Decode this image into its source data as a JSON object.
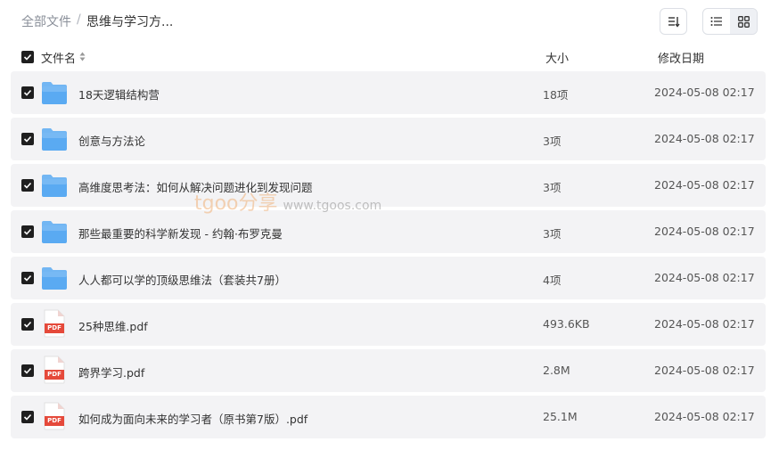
{
  "breadcrumb": {
    "root": "全部文件",
    "separator": "/",
    "current": "思维与学习方..."
  },
  "toolbar": {
    "sort_icon": "sort-icon",
    "list_view_icon": "list-view-icon",
    "grid_view_icon": "grid-view-icon",
    "active_view": "list"
  },
  "columns": {
    "name": "文件名",
    "size": "大小",
    "date": "修改日期"
  },
  "files": [
    {
      "type": "folder",
      "name": "18天逻辑结构营",
      "size": "18项",
      "date": "2024-05-08 02:17",
      "checked": true
    },
    {
      "type": "folder",
      "name": "创意与方法论",
      "size": "3项",
      "date": "2024-05-08 02:17",
      "checked": true
    },
    {
      "type": "folder",
      "name": "高维度思考法：如何从解决问题进化到发现问题",
      "size": "3项",
      "date": "2024-05-08 02:17",
      "checked": true
    },
    {
      "type": "folder",
      "name": "那些最重要的科学新发现 - 约翰·布罗克曼",
      "size": "3项",
      "date": "2024-05-08 02:17",
      "checked": true
    },
    {
      "type": "folder",
      "name": "人人都可以学的顶级思维法（套装共7册）",
      "size": "4项",
      "date": "2024-05-08 02:17",
      "checked": true
    },
    {
      "type": "pdf",
      "name": "25种思维.pdf",
      "size": "493.6KB",
      "date": "2024-05-08 02:17",
      "checked": true
    },
    {
      "type": "pdf",
      "name": "跨界学习.pdf",
      "size": "2.8M",
      "date": "2024-05-08 02:17",
      "checked": true
    },
    {
      "type": "pdf",
      "name": "如何成为面向未来的学习者（原书第7版）.pdf",
      "size": "25.1M",
      "date": "2024-05-08 02:17",
      "checked": true
    }
  ],
  "pdf_badge": "PDF",
  "watermark": {
    "brand": "tgoo分享",
    "domain": "www.tgoos.com"
  },
  "colors": {
    "folder": "#5aaaf2",
    "pdf": "#e5493a",
    "checkbox": "#1f1f1f",
    "row_bg": "#f3f3f5"
  }
}
